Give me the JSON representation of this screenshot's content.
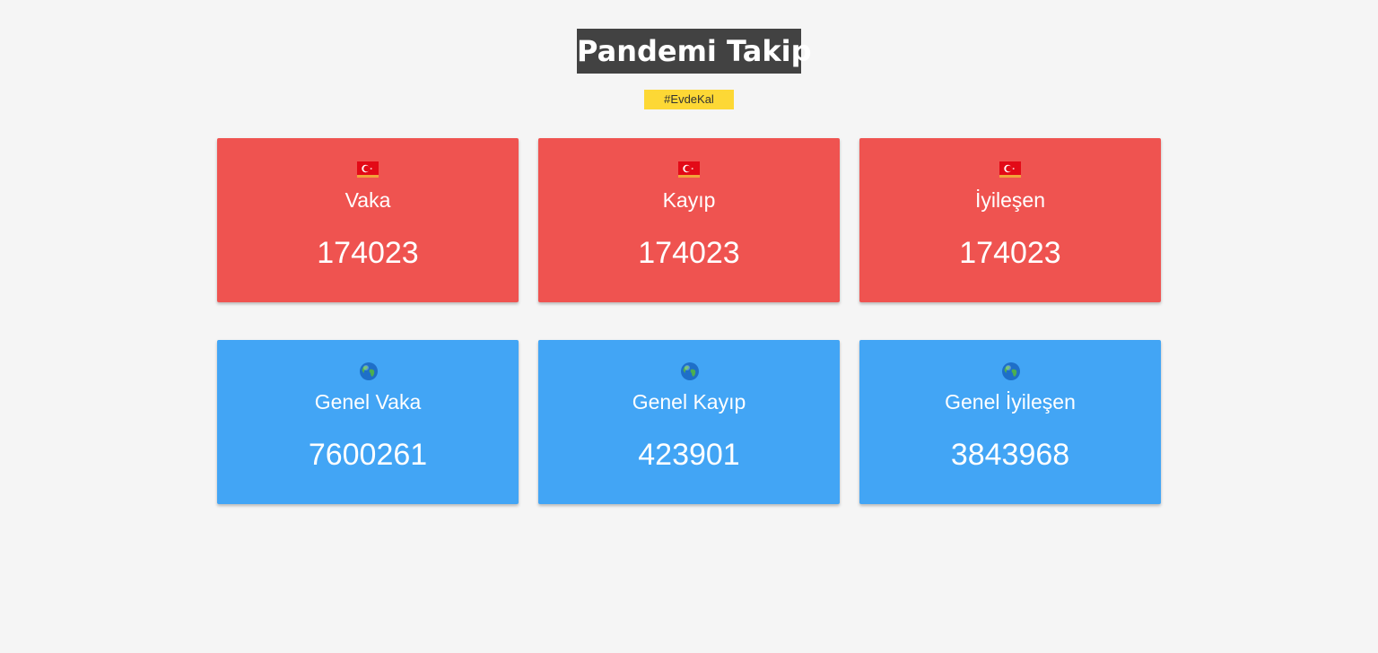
{
  "header": {
    "title": "Pandemi Takip",
    "hashtag": "#EvdeKal"
  },
  "colors": {
    "background": "#f5f5f5",
    "title_bg": "#424242",
    "hashtag_bg": "#fdd835",
    "turkey_card": "#ef5350",
    "global_card": "#42a5f5"
  },
  "turkey_stats": [
    {
      "icon": "turkey-flag-icon",
      "label": "Vaka",
      "value": "174023"
    },
    {
      "icon": "turkey-flag-icon",
      "label": "Kayıp",
      "value": "174023"
    },
    {
      "icon": "turkey-flag-icon",
      "label": "İyileşen",
      "value": "174023"
    }
  ],
  "global_stats": [
    {
      "icon": "globe-icon",
      "label": "Genel Vaka",
      "value": "7600261"
    },
    {
      "icon": "globe-icon",
      "label": "Genel Kayıp",
      "value": "423901"
    },
    {
      "icon": "globe-icon",
      "label": "Genel İyileşen",
      "value": "3843968"
    }
  ]
}
